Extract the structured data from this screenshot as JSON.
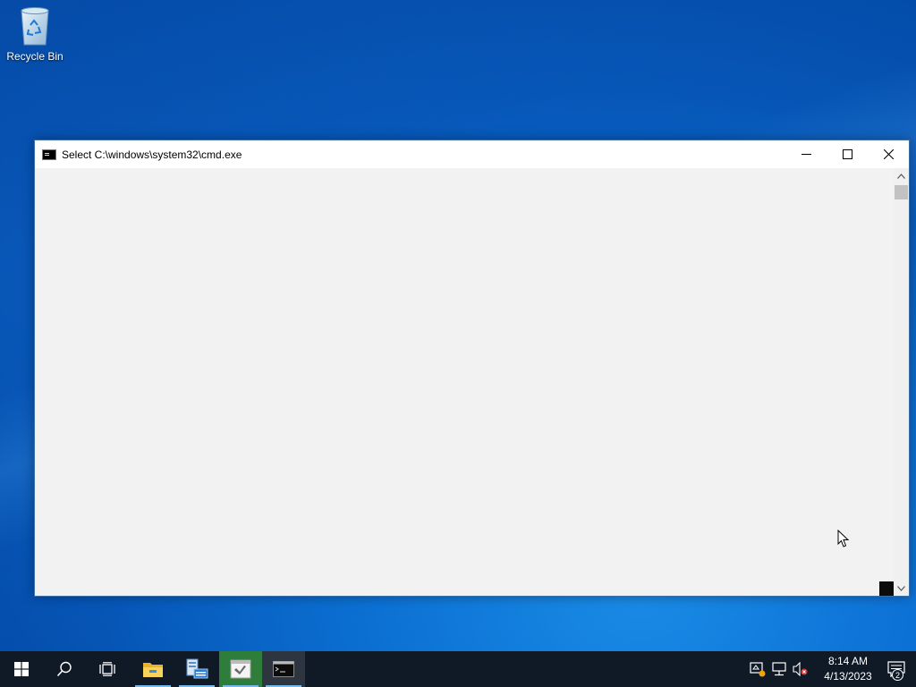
{
  "desktop": {
    "icons": [
      {
        "label": "Recycle Bin",
        "icon": "recycle-bin-icon"
      }
    ]
  },
  "window": {
    "title": "Select C:\\windows\\system32\\cmd.exe",
    "icon": "cmd-icon",
    "controls": [
      "minimize-icon",
      "maximize-icon",
      "close-icon"
    ]
  },
  "taskbar": {
    "apps": [
      {
        "name": "start",
        "icon": "windows-logo-icon"
      },
      {
        "name": "search",
        "icon": "search-icon"
      },
      {
        "name": "task-view",
        "icon": "task-view-icon"
      },
      {
        "name": "file-explorer",
        "icon": "folder-icon"
      },
      {
        "name": "server-manager",
        "icon": "server-manager-icon"
      },
      {
        "name": "app",
        "icon": "app-window-icon"
      },
      {
        "name": "command-prompt",
        "icon": "cmd-icon"
      }
    ],
    "tray": {
      "icons": [
        "action-center-warning-icon",
        "network-icon",
        "volume-muted-icon"
      ],
      "time": "8:14 AM",
      "date": "4/13/2023",
      "notification_count": "2"
    }
  },
  "colors": {
    "taskbar": "#101a26",
    "console_bg": "#f2f2f2",
    "accent": "#76b9ed"
  }
}
